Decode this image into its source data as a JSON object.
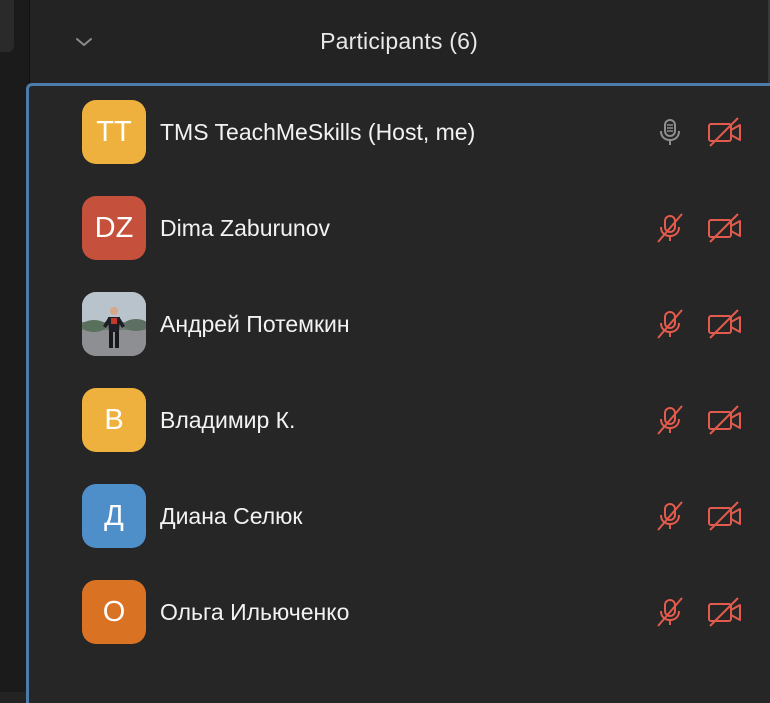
{
  "panel": {
    "title": "Participants (6)"
  },
  "colors": {
    "muted": "#e25b4d",
    "mic_on": "#8e8e8e",
    "accent_border": "#4d7cab"
  },
  "participants": [
    {
      "initials": "TT",
      "name": "TMS TeachMeSkills (Host, me)",
      "avatar_color": "#efb13d",
      "mic": "on",
      "video": "off"
    },
    {
      "initials": "DZ",
      "name": "Dima Zaburunov",
      "avatar_color": "#c5513d",
      "mic": "muted",
      "video": "off"
    },
    {
      "initials": "",
      "name": "Андрей Потемкин",
      "avatar_color": "#9aa3ad",
      "mic": "muted",
      "video": "off",
      "photo": true
    },
    {
      "initials": "В",
      "name": "Владимир К.",
      "avatar_color": "#efb13d",
      "mic": "muted",
      "video": "off"
    },
    {
      "initials": "Д",
      "name": "Диана Селюк",
      "avatar_color": "#4e8fc9",
      "mic": "muted",
      "video": "off"
    },
    {
      "initials": "О",
      "name": "Ольга Ильюченко",
      "avatar_color": "#da7224",
      "mic": "muted",
      "video": "off"
    }
  ]
}
